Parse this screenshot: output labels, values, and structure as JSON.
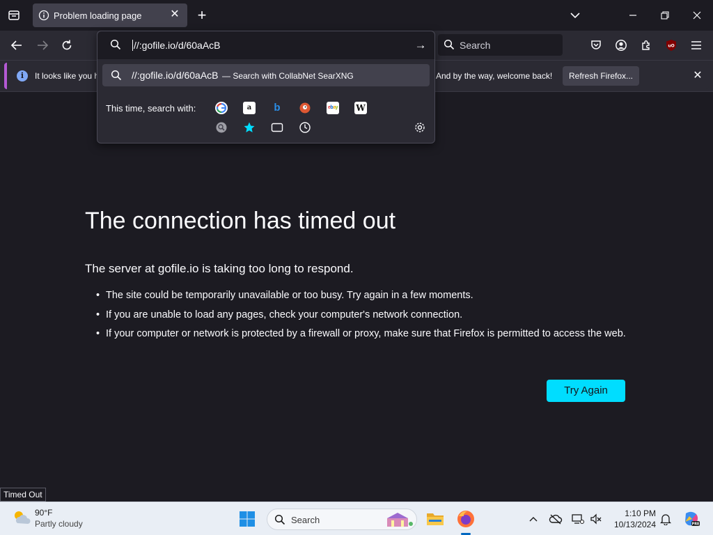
{
  "browser": {
    "tab_title": "Problem loading page",
    "search_placeholder": "Search",
    "url_value": "//:gofile.io/d/60aAcB"
  },
  "notification": {
    "text_left": "It looks like you ha",
    "text_right": "And by the way, welcome back!",
    "refresh_label": "Refresh Firefox..."
  },
  "urlbar_dropdown": {
    "suggestion_url": "//:gofile.io/d/60aAcB",
    "suggestion_action": "— Search with CollabNet SearXNG",
    "engines_label": "This time, search with:",
    "engines": [
      "google-icon",
      "amazon-icon",
      "bing-icon",
      "duckduckgo-icon",
      "ebay-icon",
      "wikipedia-icon"
    ],
    "modes": [
      "searxng-icon",
      "bookmarks-icon",
      "tabs-icon",
      "history-icon"
    ]
  },
  "error_page": {
    "title": "The connection has timed out",
    "subtitle": "The server at gofile.io is taking too long to respond.",
    "bullets": [
      "The site could be temporarily unavailable or too busy. Try again in a few moments.",
      "If you are unable to load any pages, check your computer's network connection.",
      "If your computer or network is protected by a firewall or proxy, make sure that Firefox is permitted to access the web."
    ],
    "try_again_label": "Try Again"
  },
  "status_tooltip": "Timed Out",
  "taskbar": {
    "weather_temp": "90°F",
    "weather_desc": "Partly cloudy",
    "search_label": "Search",
    "time": "1:10 PM",
    "date": "10/13/2024"
  },
  "colors": {
    "accent_cyan": "#00ddff",
    "background": "#1c1b22",
    "toolbar": "#2b2a33"
  }
}
